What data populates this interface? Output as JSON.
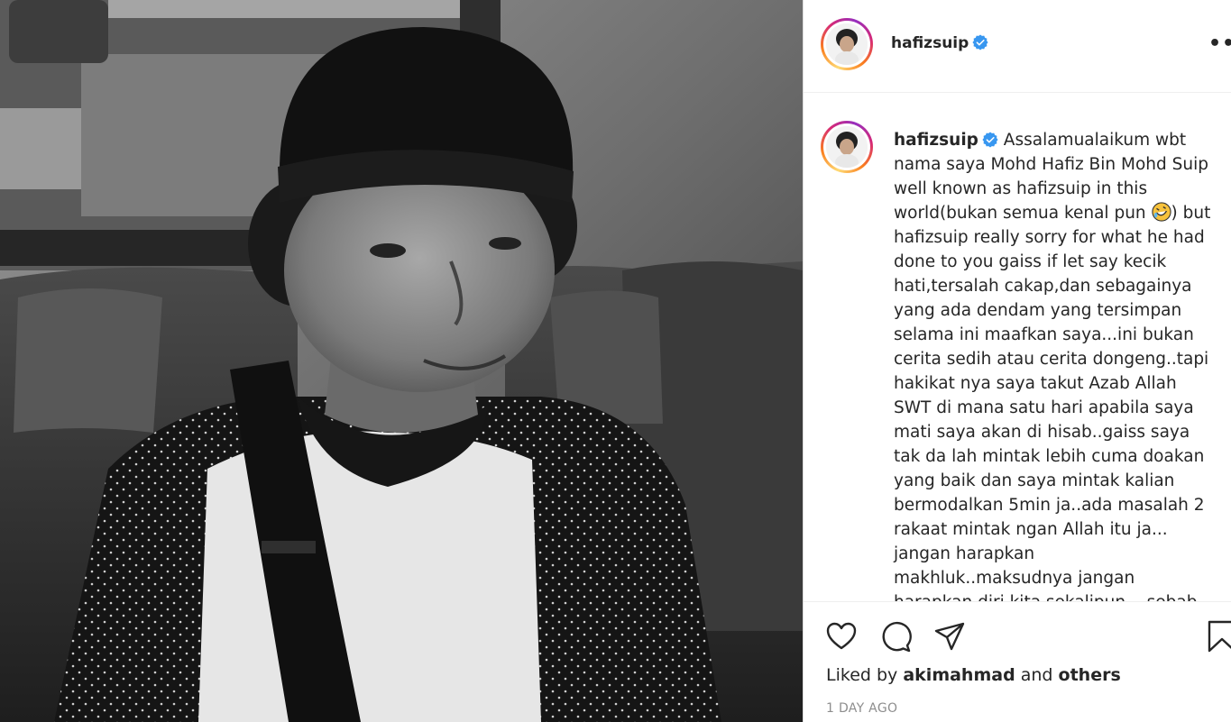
{
  "post": {
    "photo_alt": "Black and white photo of a man wearing a black beanie and a raglan shirt with a backpack strap, seated on a leather sofa",
    "username": "hafizsuip",
    "verified": true,
    "more_label": "•••"
  },
  "caption": {
    "username": "hafizsuip",
    "text_before_emoji": "Assalamualaikum wbt nama saya Mohd Hafiz Bin Mohd Suip well known as hafizsuip in this world(bukan semua kenal pun ",
    "emoji": "rolling-on-the-floor-laughing",
    "text_after_emoji": ") but hafizsuip really sorry for what he had done to you gaiss if let say kecik hati,tersalah cakap,dan sebagainya yang ada dendam yang tersimpan selama ini maafkan saya...ini bukan cerita sedih atau cerita dongeng..tapi hakikat nya saya takut Azab Allah SWT di mana satu hari apabila saya mati saya akan di hisab..gaiss saya tak da lah mintak lebih cuma doakan yang baik dan saya mintak kalian bermodalkan 5min ja..ada masalah 2 rakaat mintak ngan Allah itu ja... jangan harapkan makhluk..maksudnya jangan harapkan diri kita sekalipun... sebab semua yang ada dengan kita Dia"
  },
  "actions": {
    "like_icon": "heart-icon",
    "comment_icon": "comment-icon",
    "share_icon": "paper-plane-icon",
    "save_icon": "bookmark-icon"
  },
  "likes": {
    "prefix": "Liked by",
    "user": "akimahmad",
    "joiner": "and",
    "others": "others"
  },
  "timestamp": "1 DAY AGO",
  "colors": {
    "verified": "#3897f0",
    "text": "#262626",
    "muted": "#8e8e8e",
    "divider": "#efefef"
  }
}
